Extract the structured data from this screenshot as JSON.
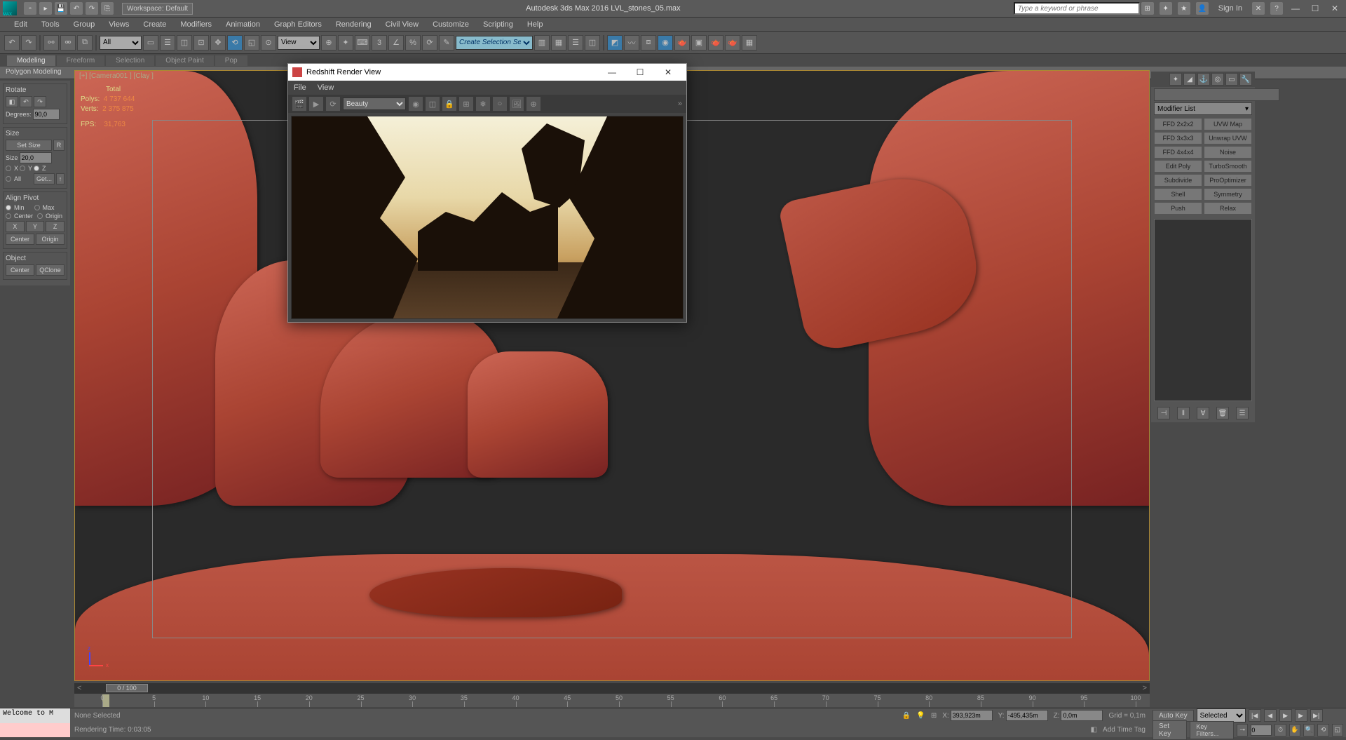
{
  "titlebar": {
    "workspace": "Workspace: Default",
    "title": "Autodesk 3ds Max 2016   LVL_stones_05.max",
    "search_placeholder": "Type a keyword or phrase",
    "signin": "Sign In"
  },
  "menubar": [
    "Edit",
    "Tools",
    "Group",
    "Views",
    "Create",
    "Modifiers",
    "Animation",
    "Graph Editors",
    "Rendering",
    "Civil View",
    "Customize",
    "Scripting",
    "Help"
  ],
  "maintoolbar": {
    "filter": "All",
    "view": "View",
    "create_sel": "Create Selection Se"
  },
  "ribbon": {
    "tabs": [
      "Modeling",
      "Freeform",
      "Selection",
      "Object Paint",
      "Pop"
    ],
    "active": 0,
    "body": "Polygon Modeling"
  },
  "left": {
    "rotate": {
      "title": "Rotate",
      "degrees_label": "Degrees:",
      "degrees": "90,0"
    },
    "size": {
      "title": "Size",
      "setSize": "Set Size",
      "r": "R",
      "size_label": "Size",
      "size": "20,0",
      "x": "X",
      "y": "Y",
      "z": "Z",
      "all": "All",
      "get": "Get..."
    },
    "align": {
      "title": "Align Pivot",
      "min": "Min",
      "max": "Max",
      "center": "Center",
      "origin": "Origin",
      "x": "X",
      "y": "Y",
      "z": "Z",
      "centerBtn": "Center",
      "originBtn": "Origin"
    },
    "object": {
      "title": "Object",
      "center": "Center",
      "qclone": "QClone"
    }
  },
  "viewport": {
    "label": "[+] [Camera001 ] [Clay ]",
    "stats": {
      "total": "Total",
      "polys_k": "Polys:",
      "polys_v": "4 737 644",
      "verts_k": "Verts:",
      "verts_v": "2 375 875",
      "fps_k": "FPS:",
      "fps_v": "31,763"
    }
  },
  "redshift": {
    "title": "Redshift Render View",
    "menu": [
      "File",
      "View"
    ],
    "pass": "Beauty"
  },
  "cmd": {
    "modlist": "Modifier List",
    "buttons": [
      "FFD 2x2x2",
      "UVW Map",
      "FFD 3x3x3",
      "Unwrap UVW",
      "FFD 4x4x4",
      "Noise",
      "Edit Poly",
      "TurboSmooth",
      "Subdivide",
      "ProOptimizer",
      "Shell",
      "Symmetry",
      "Push",
      "Relax"
    ]
  },
  "timeline": {
    "handle": "0 / 100",
    "ticks": [
      0,
      5,
      10,
      15,
      20,
      25,
      30,
      35,
      40,
      45,
      50,
      55,
      60,
      65,
      70,
      75,
      80,
      85,
      90,
      95,
      100
    ]
  },
  "status": {
    "script": "Welcome to M",
    "none": "None Selected",
    "rtime": "Rendering Time: 0:03:05",
    "x": "393,923m",
    "y": "-495,435m",
    "z": "0,0m",
    "grid": "Grid = 0,1m",
    "addtag": "Add Time Tag",
    "autokey": "Auto Key",
    "setkey": "Set Key",
    "selected": "Selected",
    "keyfilters": "Key Filters..."
  }
}
